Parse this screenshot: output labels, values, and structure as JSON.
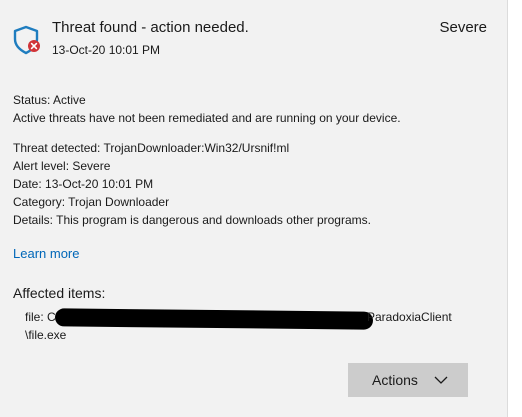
{
  "header": {
    "title": "Threat found - action needed.",
    "timestamp": "13-Oct-20 10:01 PM",
    "severity": "Severe"
  },
  "status": {
    "line": "Status:  Active",
    "description": "Active threats have not been remediated and are running on your device."
  },
  "details": {
    "threat": "Threat detected:  TrojanDownloader:Win32/Ursnif!ml",
    "alert_level": "Alert level: Severe",
    "date": "Date: 13-Oct-20 10:01 PM",
    "category": "Category:  Trojan Downloader",
    "details": "Details:  This program is dangerous and downloads other programs."
  },
  "learn_more": "Learn more",
  "affected": {
    "heading": "Affected items:",
    "file_prefix": "file: C",
    "file_suffix": "ParadoxiaClient",
    "file_line2": "\\file.exe"
  },
  "actions_button": {
    "label": "Actions"
  },
  "colors": {
    "shield": "#1f7dbf",
    "badge": "#d13438",
    "link": "#0067b8"
  }
}
